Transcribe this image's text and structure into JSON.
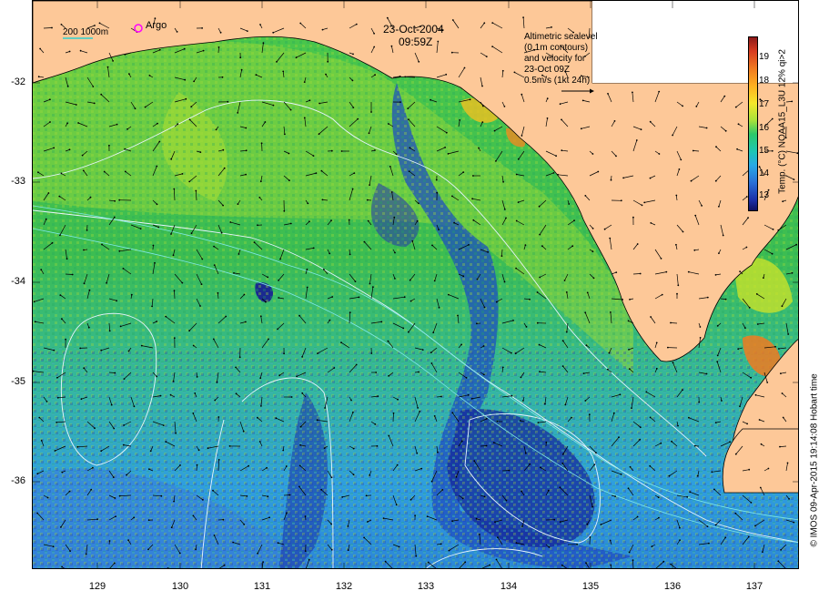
{
  "title": {
    "date": "23-Oct-2004",
    "time": "09:59Z"
  },
  "scale_legend": {
    "label": "200 1000m",
    "argo_label": "Argo",
    "argo_color": "#ff00ff"
  },
  "altimetry_legend": {
    "lines": [
      "Altimetric sealevel",
      "(0.1m contours)",
      "and velocity for",
      "23-Oct 09Z",
      "0.5m/s (1kt 24h)"
    ]
  },
  "colorbar": {
    "title": "Temp. (°C) NOAA15_L3U 12% qi>2",
    "ticks": [
      "19",
      "18",
      "17",
      "16",
      "15",
      "14",
      "13"
    ],
    "range": [
      12.5,
      19.5
    ]
  },
  "axes": {
    "latitude_labels": [
      "-32",
      "-33",
      "-34",
      "-35",
      "-36"
    ],
    "longitude_labels": [
      "129",
      "130",
      "131",
      "132",
      "133",
      "134",
      "135",
      "136",
      "137"
    ],
    "lon_range": [
      128.2,
      137.5
    ],
    "lat_range": [
      -31.2,
      -36.9
    ]
  },
  "credit": "© IMOS 09-Apr-2015 19:14:08 Hobart time",
  "colors": {
    "land": "#fdc898",
    "ocean_green": "#4cc648",
    "ocean_blue": "#2a8ee0",
    "ocean_deep": "#1b3cb0",
    "contour": "#e8f4ff"
  }
}
